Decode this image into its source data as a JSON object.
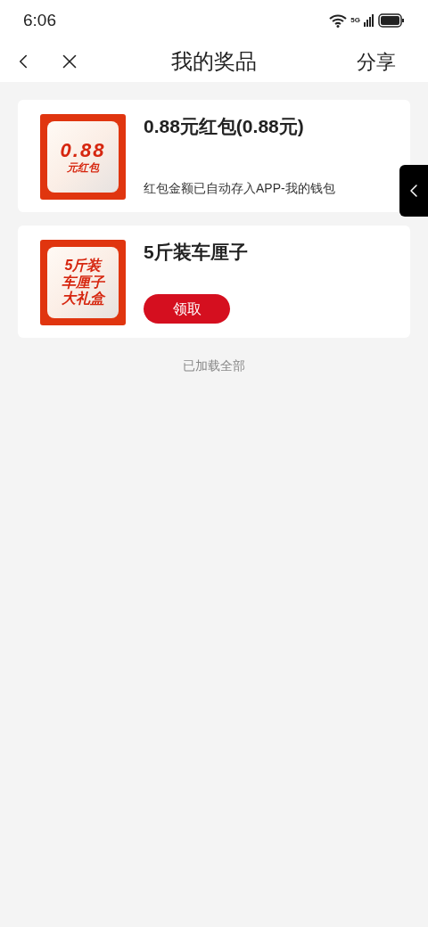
{
  "status_bar": {
    "time": "6:06",
    "network": "5G"
  },
  "nav": {
    "title": "我的奖品",
    "share": "分享"
  },
  "prizes": [
    {
      "kind": "note",
      "thumb_lines": [
        "0.88",
        "元红包"
      ],
      "title": "0.88元红包(0.88元)",
      "note": "红包金额已自动存入APP-我的钱包"
    },
    {
      "kind": "button",
      "thumb_lines": [
        "5斤装",
        "车厘子",
        "大礼盒"
      ],
      "title": "5斤装车厘子",
      "button": "领取"
    }
  ],
  "footer": "已加载全部"
}
